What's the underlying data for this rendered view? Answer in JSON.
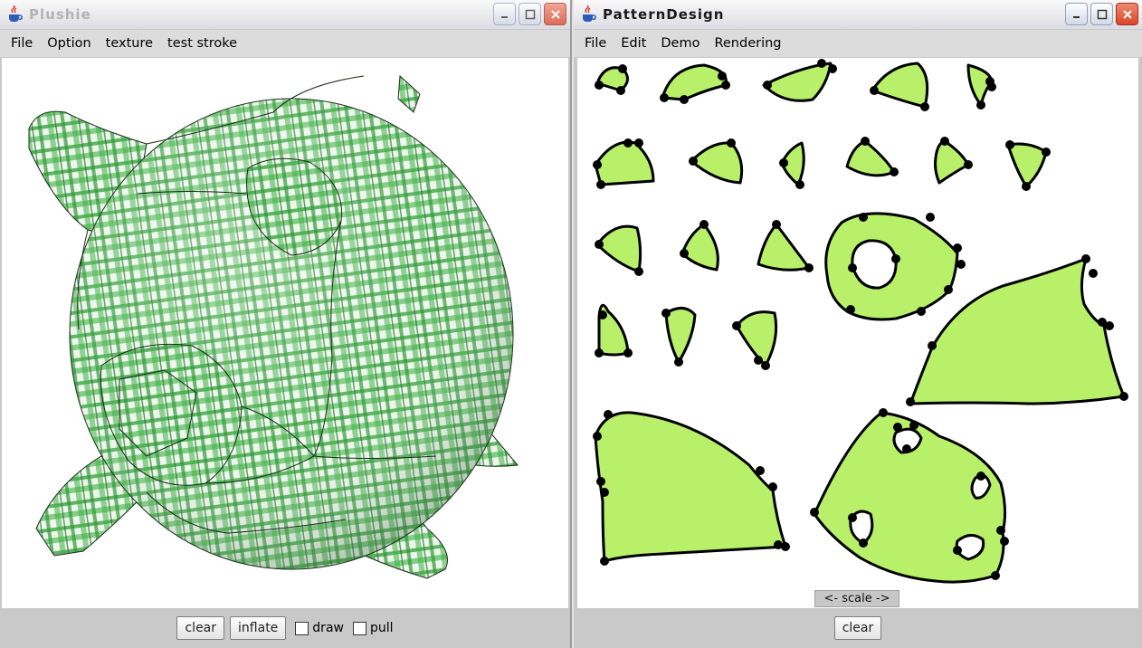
{
  "plushie_window": {
    "title": "Plushie",
    "menu": [
      "File",
      "Option",
      "texture",
      "test stroke"
    ],
    "buttons": {
      "clear": "clear",
      "inflate": "inflate"
    },
    "checkboxes": {
      "draw": "draw",
      "pull": "pull"
    }
  },
  "pattern_window": {
    "title": "PatternDesign",
    "menu": [
      "File",
      "Edit",
      "Demo",
      "Rendering"
    ],
    "scale_label": "<- scale ->",
    "buttons": {
      "clear": "clear"
    }
  },
  "colors": {
    "pattern_fill": "#b8f06a",
    "plaid_green": "#2e9c35",
    "titlebar_icon": "java-cup-icon"
  }
}
